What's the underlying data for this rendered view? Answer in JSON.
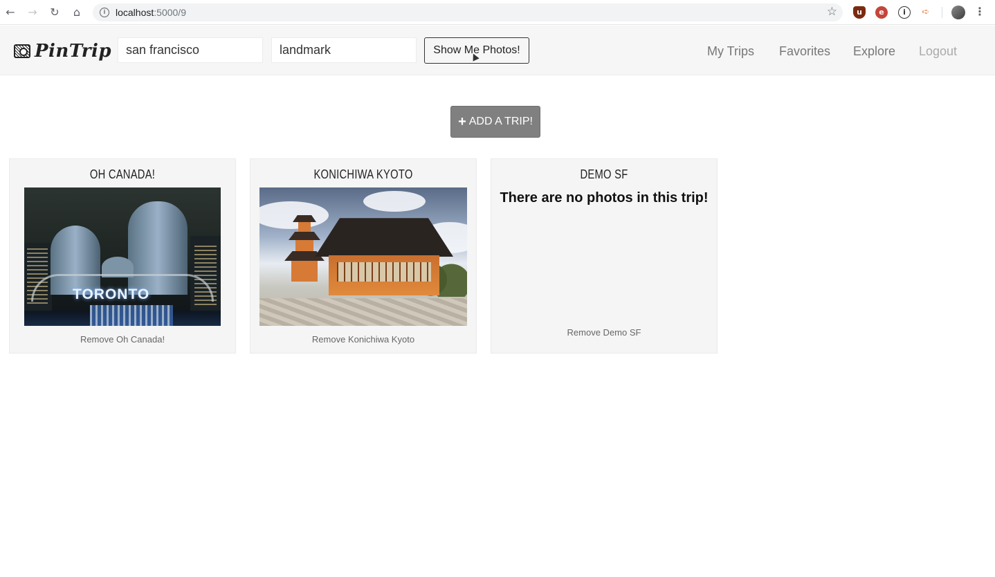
{
  "browser": {
    "url_host": "localhost",
    "url_path": ":5000/9"
  },
  "navbar": {
    "logo_text": "PinTrip",
    "search_location_value": "san francisco",
    "search_category_value": "landmark",
    "show_photos_label": "Show Me Photos!",
    "links": {
      "my_trips": "My Trips",
      "favorites": "Favorites",
      "explore": "Explore",
      "logout": "Logout"
    }
  },
  "main": {
    "add_trip_label": "ADD A TRIP!",
    "trips": [
      {
        "title": "OH CANADA!",
        "remove_label": "Remove Oh Canada!",
        "photo_sign_text": "TORONTO"
      },
      {
        "title": "KONICHIWA KYOTO",
        "remove_label": "Remove Konichiwa Kyoto"
      },
      {
        "title": "DEMO SF",
        "empty_message": "There are no photos in this trip!",
        "remove_label": "Remove Demo SF"
      }
    ]
  }
}
